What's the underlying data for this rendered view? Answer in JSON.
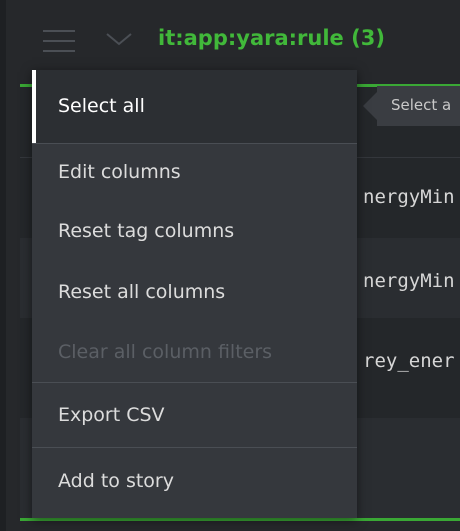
{
  "header": {
    "title": "it:app:yara:rule (3)",
    "menu_icon": "hamburger-icon",
    "expand_icon": "chevron-down-icon"
  },
  "table": {
    "rows": [
      {
        "text": "nergyMin"
      },
      {
        "text": "nergyMin"
      },
      {
        "text": "rey_ener"
      }
    ]
  },
  "tooltip": {
    "text": "Select a"
  },
  "menu": {
    "items": [
      {
        "label": "Select all",
        "state": "active"
      },
      {
        "label": "Edit columns",
        "state": "normal"
      },
      {
        "label": "Reset tag columns",
        "state": "normal"
      },
      {
        "label": "Reset all columns",
        "state": "normal"
      },
      {
        "label": "Clear all column filters",
        "state": "disabled"
      },
      {
        "label": "Export CSV",
        "state": "normal"
      },
      {
        "label": "Add to story",
        "state": "normal"
      }
    ]
  },
  "colors": {
    "accent": "#41b83a",
    "menu_bg": "#35383d",
    "background": "#26282b"
  }
}
